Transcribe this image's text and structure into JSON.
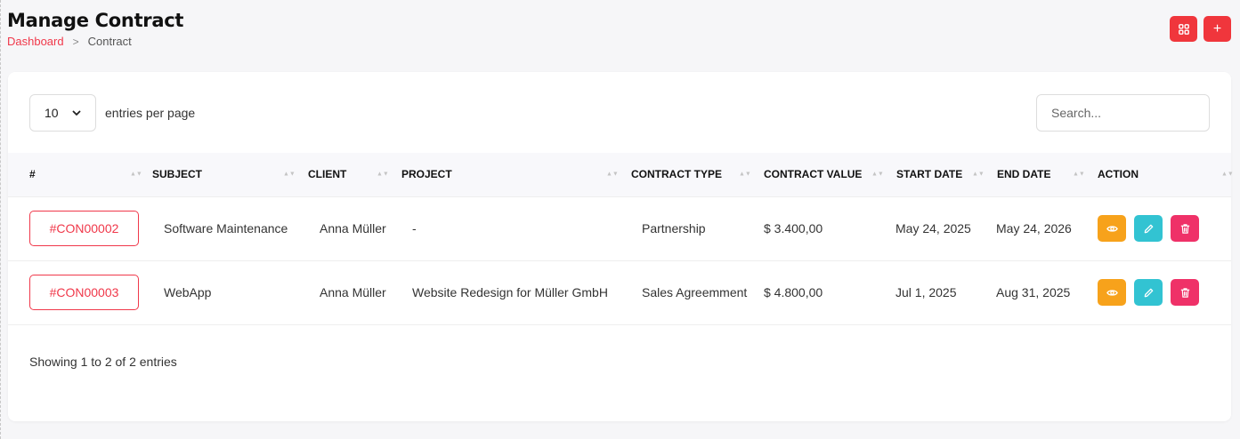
{
  "header": {
    "title": "Manage Contract",
    "breadcrumb": {
      "link": "Dashboard",
      "separator": ">",
      "current": "Contract"
    },
    "actions": {
      "grid_icon": "grid-icon",
      "add_label": "+"
    }
  },
  "toolbar": {
    "entries_value": "10",
    "entries_label": "entries per page",
    "search_placeholder": "Search..."
  },
  "table": {
    "columns": [
      "#",
      "SUBJECT",
      "CLIENT",
      "PROJECT",
      "CONTRACT TYPE",
      "CONTRACT VALUE",
      "START DATE",
      "END DATE",
      "ACTION"
    ],
    "rows": [
      {
        "id": "#CON00002",
        "subject": "Software Maintenance",
        "client": "Anna Müller",
        "project": "-",
        "type": "Partnership",
        "value": "$ 3.400,00",
        "start": "May 24, 2025",
        "end": "May 24, 2026"
      },
      {
        "id": "#CON00003",
        "subject": "WebApp",
        "client": "Anna Müller",
        "project": "Website Redesign for Müller GmbH",
        "type": "Sales Agreemment",
        "value": "$ 4.800,00",
        "start": "Jul 1, 2025",
        "end": "Aug 31, 2025"
      }
    ]
  },
  "footer": {
    "showing": "Showing 1 to 2 of 2 entries"
  },
  "colors": {
    "accent": "#f0384a",
    "view": "#f7a21b",
    "edit": "#32c3d2",
    "delete": "#ef3168"
  }
}
